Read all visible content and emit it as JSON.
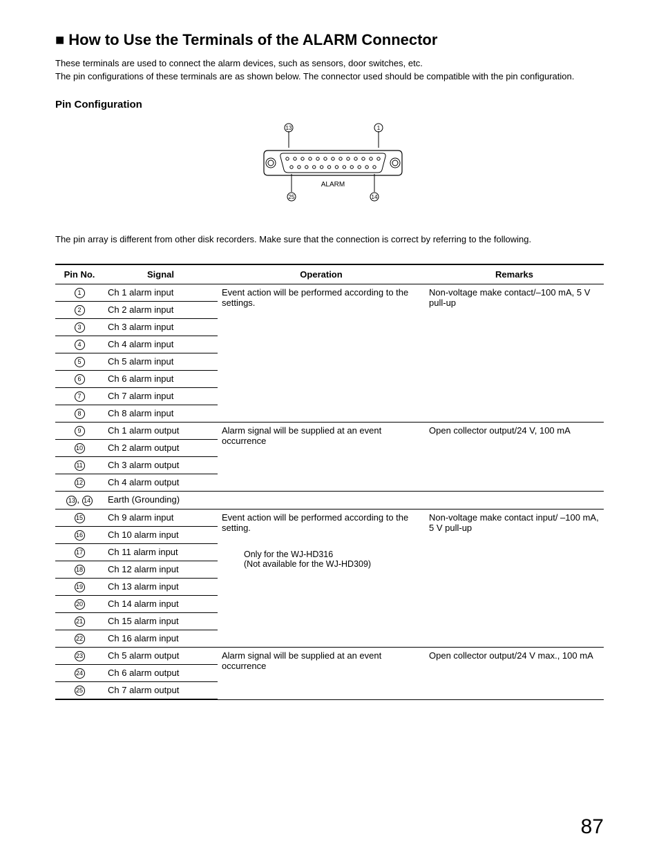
{
  "title": "How to Use the Terminals of the ALARM Connector",
  "intro": "These terminals are used to connect the alarm devices, such as sensors, door switches, etc.\nThe pin configurations of these terminals are as shown below. The connector used should be compatible with the pin configuration.",
  "subsection": "Pin Configuration",
  "diagram": {
    "label": "ALARM",
    "markers": {
      "top_left": "13",
      "top_right": "1",
      "bottom_left": "25",
      "bottom_right": "14"
    },
    "pins_top_row": 13,
    "pins_bottom_row": 12
  },
  "note_after_diagram": "The pin array is different from other disk recorders. Make sure that the connection is correct by referring to the following.",
  "table": {
    "headers": {
      "pin": "Pin No.",
      "signal": "Signal",
      "operation": "Operation",
      "remarks": "Remarks"
    },
    "groups": [
      {
        "operation": "Event action will be performed according to the settings.",
        "remarks": "Non-voltage make contact/–100 mA, 5 V pull-up",
        "rows": [
          {
            "pin": "1",
            "signal": "Ch 1 alarm input"
          },
          {
            "pin": "2",
            "signal": "Ch 2 alarm input"
          },
          {
            "pin": "3",
            "signal": "Ch 3 alarm input"
          },
          {
            "pin": "4",
            "signal": "Ch 4 alarm input"
          },
          {
            "pin": "5",
            "signal": "Ch 5 alarm input"
          },
          {
            "pin": "6",
            "signal": "Ch 6 alarm input"
          },
          {
            "pin": "7",
            "signal": "Ch 7 alarm input"
          },
          {
            "pin": "8",
            "signal": "Ch 8 alarm input"
          }
        ]
      },
      {
        "operation": "Alarm signal will be supplied at an event occurrence",
        "remarks": "Open collector output/24 V, 100 mA",
        "rows": [
          {
            "pin": "9",
            "signal": "Ch 1 alarm output"
          },
          {
            "pin": "10",
            "signal": "Ch 2 alarm output"
          },
          {
            "pin": "11",
            "signal": "Ch 3 alarm output"
          },
          {
            "pin": "12",
            "signal": "Ch 4 alarm output"
          }
        ]
      },
      {
        "operation": "",
        "remarks": "",
        "rows": [
          {
            "pin": "13, 14",
            "signal": "Earth (Grounding)"
          }
        ]
      },
      {
        "operation": "Event action will be performed according to the setting.",
        "operation_sub": "Only for the WJ-HD316\n(Not available for the WJ-HD309)",
        "remarks": "Non-voltage make contact input/ –100 mA, 5 V pull-up",
        "rows": [
          {
            "pin": "15",
            "signal": "Ch 9 alarm input"
          },
          {
            "pin": "16",
            "signal": "Ch 10 alarm input"
          },
          {
            "pin": "17",
            "signal": "Ch 11 alarm input"
          },
          {
            "pin": "18",
            "signal": "Ch 12 alarm input"
          },
          {
            "pin": "19",
            "signal": "Ch 13 alarm input"
          },
          {
            "pin": "20",
            "signal": "Ch 14 alarm input"
          },
          {
            "pin": "21",
            "signal": "Ch 15 alarm input"
          },
          {
            "pin": "22",
            "signal": "Ch 16 alarm input"
          }
        ]
      },
      {
        "operation": "Alarm signal will be supplied at an event occurrence",
        "remarks": "Open collector output/24 V max., 100 mA",
        "rows": [
          {
            "pin": "23",
            "signal": "Ch 5 alarm output"
          },
          {
            "pin": "24",
            "signal": "Ch 6 alarm output"
          },
          {
            "pin": "25",
            "signal": "Ch 7 alarm output"
          }
        ]
      }
    ]
  },
  "page_number": "87"
}
